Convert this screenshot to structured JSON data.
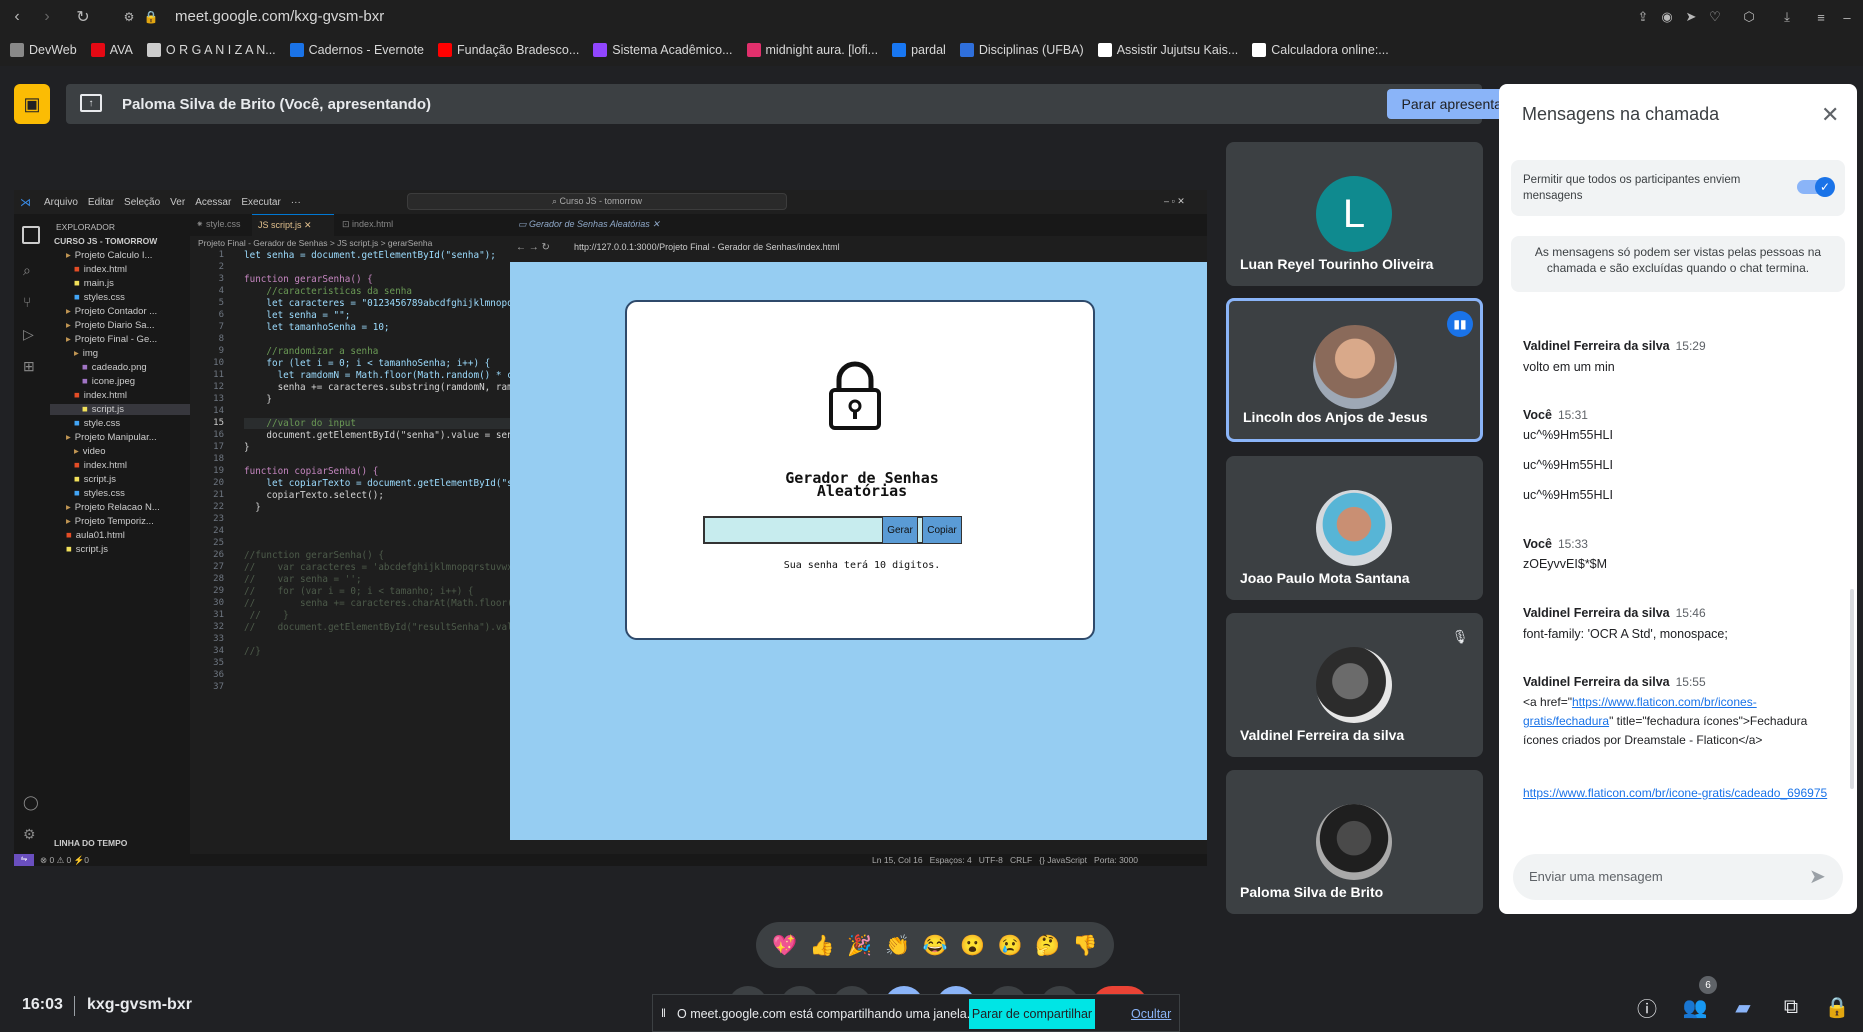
{
  "browser": {
    "url": "meet.google.com/kxg-gvsm-bxr",
    "bookmarks": [
      "DevWeb",
      "AVA",
      "O R G A N I Z A N...",
      "Cadernos - Evernote",
      "Fundação Bradesco...",
      "Sistema Acadêmico...",
      "midnight aura. [lofi...",
      "pardal",
      "Disciplinas (UFBA)",
      "Assistir Jujutsu Kais...",
      "Calculadora online:..."
    ]
  },
  "meet": {
    "presenting_label": "Paloma Silva de Brito (Você, apresentando)",
    "stop_presenting": "Parar apresentação",
    "time": "16:03",
    "meeting_code": "kxg-gvsm-bxr",
    "people_count": "6",
    "participants": [
      {
        "name": "Luan Reyel Tourinho Oliveira",
        "initial": "L",
        "color": "#0f8a8f"
      },
      {
        "name": "Lincoln dos Anjos de Jesus"
      },
      {
        "name": "Joao Paulo Mota Santana"
      },
      {
        "name": "Valdinel Ferreira da silva"
      },
      {
        "name": "Paloma Silva de Brito"
      }
    ],
    "sharing_banner": {
      "text": "O meet.google.com está compartilhando uma janela.",
      "stop": "Parar de compartilhar",
      "hide": "Ocultar"
    },
    "reactions": [
      "💖",
      "👍",
      "🎉",
      "👏",
      "😂",
      "😮",
      "😢",
      "🤔",
      "👎"
    ]
  },
  "chat": {
    "title": "Mensagens na chamada",
    "permission": "Permitir que todos os participantes enviem mensagens",
    "info": "As mensagens só podem ser vistas pelas pessoas na chamada e são excluídas quando o chat termina.",
    "input_placeholder": "Enviar uma mensagem",
    "messages": [
      {
        "sender": "Valdinel Ferreira da silva",
        "time": "15:29",
        "lines": [
          "volto em um min"
        ]
      },
      {
        "sender": "Você",
        "time": "15:31",
        "lines": [
          "uc^%9Hm55HLI",
          "uc^%9Hm55HLI",
          "uc^%9Hm55HLI"
        ]
      },
      {
        "sender": "Você",
        "time": "15:33",
        "lines": [
          "zOEyvvEI$*$M"
        ]
      },
      {
        "sender": "Valdinel Ferreira da silva",
        "time": "15:46",
        "lines": [
          "font-family: 'OCR A Std', monospace;"
        ]
      },
      {
        "sender": "Valdinel Ferreira da silva",
        "time": "15:55",
        "html_pre": "<a href=\"",
        "link1": "https://www.flaticon.com/br/icones-gratis/fechadura",
        "html_post": "\" title=\"fechadura ícones\">Fechadura ícones criados por Dreamstale - Flaticon</a>",
        "link2": "https://www.flaticon.com/br/icone-gratis/cadeado_696975"
      }
    ]
  },
  "vscode": {
    "menu": [
      "Arquivo",
      "Editar",
      "Seleção",
      "Ver",
      "Acessar",
      "Executar",
      "···"
    ],
    "search": "Curso JS - tomorrow",
    "explorer_title": "EXPLORADOR",
    "workspace": "CURSO JS - TOMORROW",
    "tree": [
      "Projeto Calculo I...",
      "index.html",
      "main.js",
      "styles.css",
      "Projeto Contador ...",
      "Projeto Diario Sa...",
      "Projeto Final - Ge...",
      "img",
      "cadeado.png",
      "icone.jpeg",
      "index.html",
      "script.js",
      "style.css",
      "Projeto Manipular...",
      "video",
      "index.html",
      "script.js",
      "styles.css",
      "Projeto Relacao N...",
      "Projeto Temporiz...",
      "aula01.html",
      "script.js"
    ],
    "timeline": "LINHA DO TEMPO",
    "tabs": [
      "style.css",
      "script.js",
      "index.html",
      "Gerador de Senhas Aleatórias"
    ],
    "breadcrumb": "Projeto Final - Gerador de Senhas  >  JS script.js  >  gerarSenha",
    "preview_url": "http://127.0.0.1:3000/Projeto Final - Gerador de Senhas/index.html",
    "code": [
      "let senha = document.getElementById(\"senha\");",
      "",
      "function gerarSenha() {",
      "    //caracteristicas da senha",
      "    let caracteres = \"0123456789abcdfghijklmnopqr",
      "    let senha = \"\";",
      "    let tamanhoSenha = 10;",
      "",
      "    //randomizar a senha",
      "    for (let i = 0; i < tamanhoSenha; i++) {",
      "      let ramdomN = Math.floor(Math.random() * ca",
      "      senha += caracteres.substring(ramdomN, ramd",
      "    }",
      "",
      "    //valor do input",
      "    document.getElementById(\"senha\").value = senh",
      "}",
      "",
      "function copiarSenha() {",
      "    let copiarTexto = document.getElementById(\"se",
      "    copiarTexto.select();",
      "  }",
      "",
      "",
      "",
      "//function gerarSenha() {",
      "//    var caracteres = 'abcdefghijklmnopqrstuvwxy",
      "//    var senha = '';",
      "//    for (var i = 0; i < tamanho; i++) {",
      "//        senha += caracteres.charAt(Math.floor(M",
      " //    }",
      "//    document.getElementById(\"resultSenha\").valu",
      "",
      "//}",
      "",
      "",
      ""
    ],
    "status": "Ln 15, Col 16   Espaços: 4   UTF-8   CRLF   {} JavaScript   Porta: 3000",
    "status_left": "⊗ 0 ⚠ 0   ⚡0"
  },
  "app": {
    "title_line1": "Gerador de Senhas",
    "title_line2": "Aleatórias",
    "btn_generate": "Gerar",
    "btn_copy": "Copiar",
    "note": "Sua senha terá 10 digitos."
  }
}
